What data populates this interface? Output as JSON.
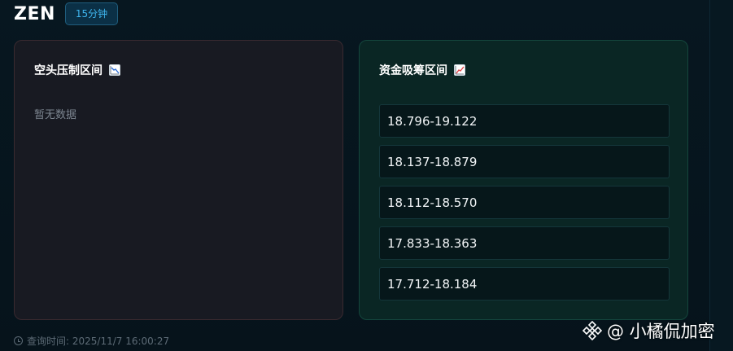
{
  "header": {
    "symbol": "ZEN",
    "interval": "15分钟"
  },
  "short_pressure": {
    "title": "空头压制区间",
    "icon": "chart-decreasing-icon",
    "empty_text": "暂无数据"
  },
  "accumulation": {
    "title": "资金吸筹区间",
    "icon": "chart-increasing-icon",
    "ranges": [
      "18.796-19.122",
      "18.137-18.879",
      "18.112-18.570",
      "17.833-18.363",
      "17.712-18.184"
    ]
  },
  "footer": {
    "query_time": "查询时间: 2025/11/7 16:00:27"
  },
  "watermark": {
    "text": "@ 小橘侃加密",
    "logo": "binance-logo-icon"
  },
  "colors": {
    "background": "#06121a",
    "accent_blue": "#3fb6ef",
    "short_card_bg": "#181a22",
    "accumulation_card_bg": "#0a2624",
    "decrease_red": "#e5484d",
    "increase_red": "#e5484d"
  }
}
